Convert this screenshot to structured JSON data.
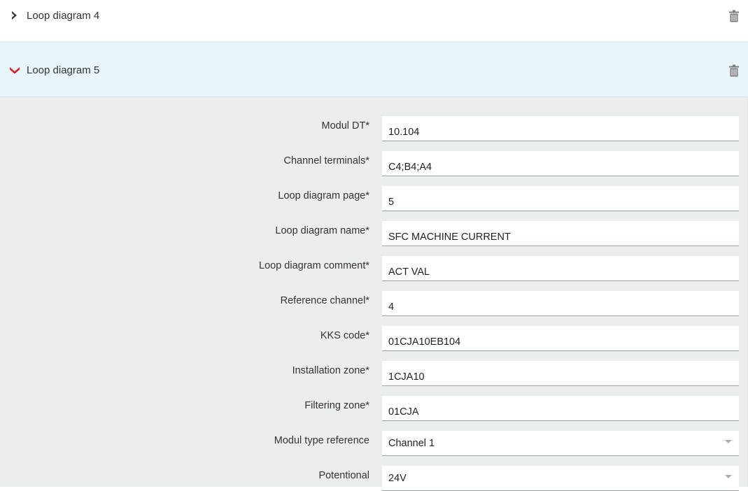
{
  "accordion": {
    "items": [
      {
        "title": "Loop diagram 4",
        "expanded": false
      },
      {
        "title": "Loop diagram 5",
        "expanded": true
      }
    ],
    "icons": {
      "collapsed": "chevron-right-icon",
      "expanded": "chevron-down-icon",
      "delete": "trash-icon"
    },
    "colors": {
      "expanded_bg": "#e8f6fc",
      "chevron_expanded": "#d0202e",
      "chevron_collapsed": "#333333"
    }
  },
  "form": {
    "fields": [
      {
        "label": "Modul DT*",
        "value": "10.104"
      },
      {
        "label": "Channel terminals*",
        "value": "C4;B4;A4"
      },
      {
        "label": "Loop diagram page*",
        "value": "5"
      },
      {
        "label": "Loop diagram name*",
        "value": "SFC MACHINE CURRENT"
      },
      {
        "label": "Loop diagram comment*",
        "value": "ACT VAL"
      },
      {
        "label": "Reference channel*",
        "value": "4"
      },
      {
        "label": "KKS code*",
        "value": "01CJA10EB104"
      },
      {
        "label": "Installation zone*",
        "value": "1CJA10"
      },
      {
        "label": "Filtering zone*",
        "value": "01CJA"
      }
    ],
    "selects": [
      {
        "label": "Modul type reference",
        "value": "Channel 1"
      },
      {
        "label": "Potentional",
        "value": "24V"
      }
    ],
    "background": "#eceeee"
  }
}
